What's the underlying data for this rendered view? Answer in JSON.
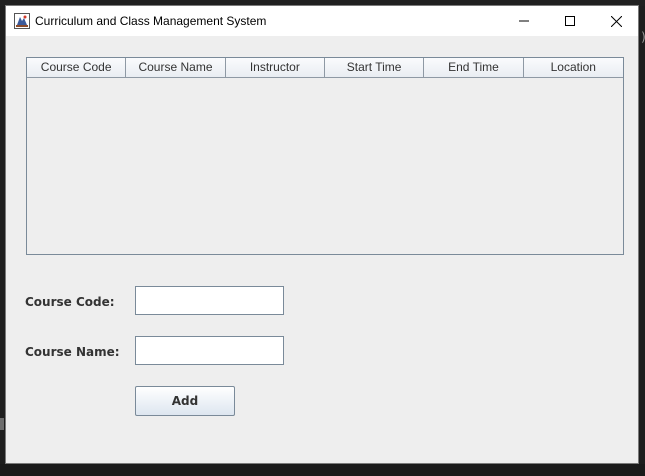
{
  "window": {
    "title": "Curriculum and Class Management System",
    "controls": {
      "minimize": "minimize-icon",
      "maximize": "maximize-icon",
      "close": "close-icon"
    }
  },
  "table": {
    "columns": [
      "Course Code",
      "Course Name",
      "Instructor",
      "Start Time",
      "End Time",
      "Location"
    ],
    "rows": []
  },
  "form": {
    "course_code_label": "Course Code:",
    "course_code_value": "",
    "course_name_label": "Course Name:",
    "course_name_value": "",
    "add_label": "Add"
  },
  "colors": {
    "window_bg": "#eeeeee",
    "titlebar_bg": "#ffffff",
    "border": "#7a8a99"
  }
}
